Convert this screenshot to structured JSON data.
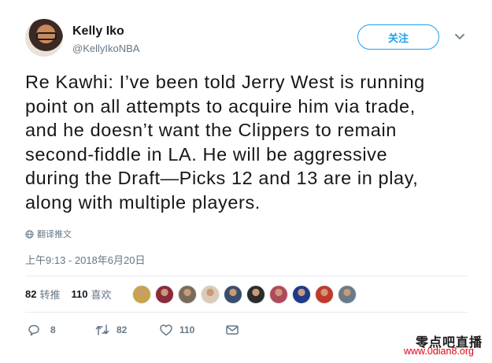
{
  "author": {
    "name": "Kelly Iko",
    "handle": "@KellyIkoNBA"
  },
  "follow_button_label": "关注",
  "tweet": {
    "lines": [
      "Re Kawhi: I’ve been told Jerry West is running",
      "point on all attempts to acquire him via trade,",
      "and he doesn’t want the Clippers to remain",
      "second-fiddle in LA. He will be aggressive",
      "during the Draft—Picks 12 and 13 are in play,",
      "along with multiple players."
    ]
  },
  "translate_label": "翻译推文",
  "timestamp": "上午9:13 - 2018年6月20日",
  "stats": {
    "retweets_count": "82",
    "retweets_label": "转推",
    "likes_count": "110",
    "likes_label": "喜欢"
  },
  "liker_avatar_colors": [
    "#c9a24a",
    "#8a2a3a",
    "#7a6a5a",
    "#d9cbb8",
    "#3a4d6a",
    "#2c2c2c",
    "#b04a5a",
    "#1e3a8a",
    "#c0392b",
    "#6a7a8a"
  ],
  "actions": {
    "reply_count": "8",
    "retweet_count": "82",
    "like_count": "110"
  },
  "watermark": {
    "site_name": "零点吧直播",
    "url": "www.0dian8.org"
  },
  "colors": {
    "accent": "#1da1f2",
    "secondary_text": "#657786",
    "watermark_url": "#e60012"
  }
}
